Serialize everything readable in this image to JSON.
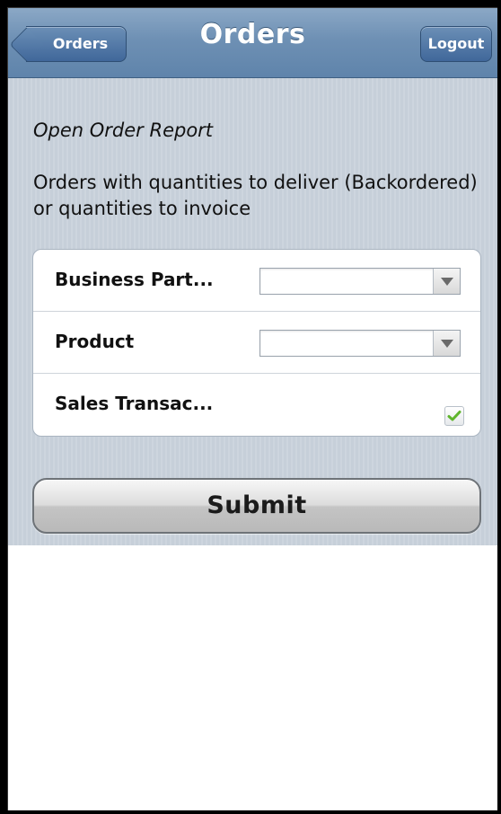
{
  "header": {
    "title": "Orders",
    "back_label": "Orders",
    "logout_label": "Logout"
  },
  "content": {
    "subtitle": "Open Order Report",
    "description": "Orders with quantities to deliver (Backordered) or quantities to invoice"
  },
  "form": {
    "rows": [
      {
        "label": "Business Part...",
        "type": "select",
        "value": ""
      },
      {
        "label": "Product",
        "type": "select",
        "value": ""
      },
      {
        "label": "Sales Transac...",
        "type": "checkbox",
        "checked": true
      }
    ]
  },
  "submit_label": "Submit",
  "colors": {
    "header": "#6e90b4",
    "content_bg": "#c6cfd9",
    "checkmark": "#5fb52d"
  }
}
